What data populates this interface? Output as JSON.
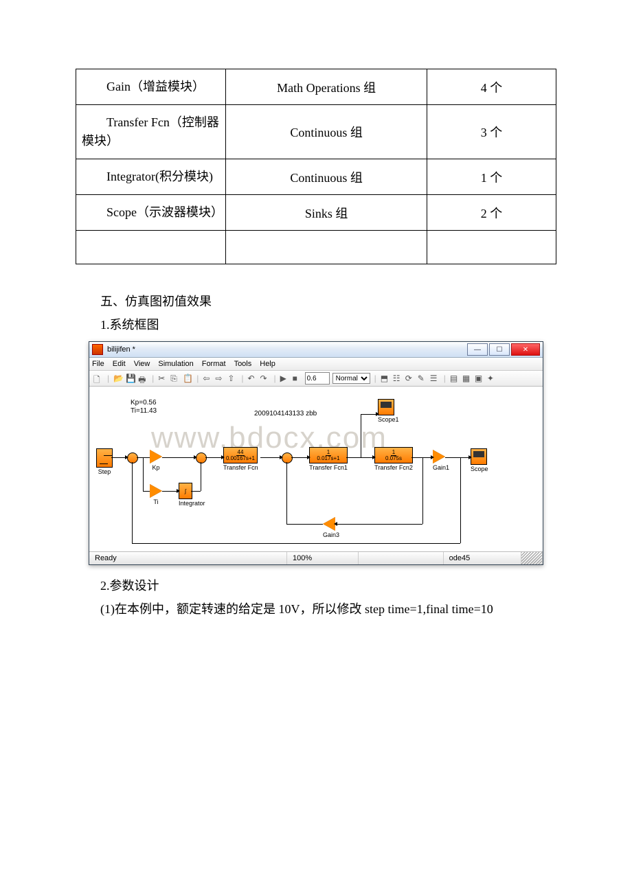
{
  "table": {
    "rows": [
      {
        "c1": "Gain（增益模块）",
        "c2": "Math Operations 组",
        "c3": "4 个"
      },
      {
        "c1": "Transfer Fcn（控制器模块）",
        "c2": "Continuous 组",
        "c3": "3 个"
      },
      {
        "c1": "Integrator(积分模块)",
        "c2": "Continuous 组",
        "c3": "1 个"
      },
      {
        "c1": "Scope（示波器模块）",
        "c2": "Sinks 组",
        "c3": "2 个"
      }
    ]
  },
  "section5": "五、仿真图初值效果",
  "sub1": "1.系统框图",
  "sub2": "2.参数设计",
  "para1": "(1)在本例中，额定转速的给定是 10V，所以修改 step time=1,final time=10",
  "watermark": "www.bdocx.com",
  "simwin": {
    "title": "bilijifen *",
    "menus": [
      "File",
      "Edit",
      "View",
      "Simulation",
      "Format",
      "Tools",
      "Help"
    ],
    "stoptime": "0.6",
    "mode": "Normal",
    "note_kp": "Kp=0.56",
    "note_ti": "Ti=11.43",
    "note_id": "2009104143133 zbb",
    "labels": {
      "step": "Step",
      "kp": "Kp",
      "ti": "Ti",
      "integ": "Integrator",
      "tf": "Transfer Fcn",
      "tf1": "Transfer Fcn1",
      "tf2": "Transfer Fcn2",
      "gain1": "Gain1",
      "gain3": "Gain3",
      "scope": "Scope",
      "scope1": "Scope1"
    },
    "tf_num": "44",
    "tf_den": "0.00167s+1",
    "tf1_num": "1",
    "tf1_den": "0.017s+1",
    "tf2_num": "1",
    "tf2_den": "0.075s",
    "integ_txt": "1\ns",
    "status_ready": "Ready",
    "status_zoom": "100%",
    "status_solver": "ode45"
  },
  "winbtn": {
    "min": "—",
    "max": "☐",
    "close": "✕"
  }
}
